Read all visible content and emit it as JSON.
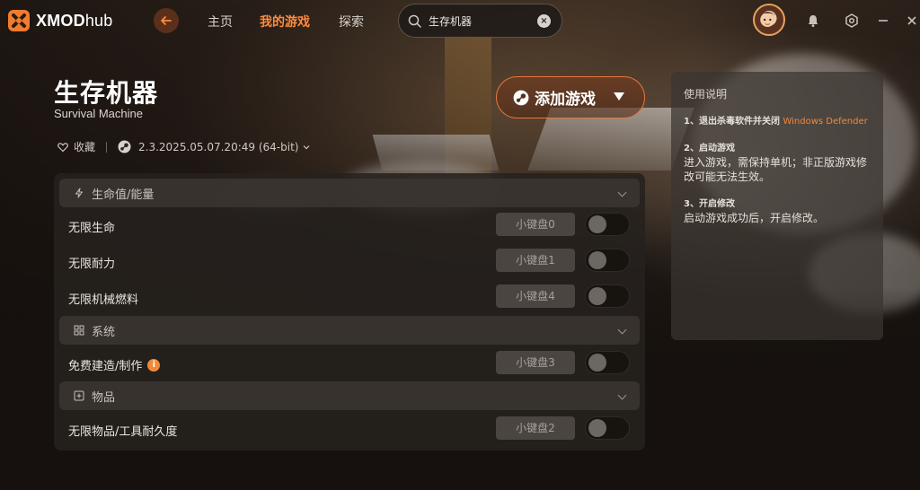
{
  "app": {
    "name_part1": "XMOD",
    "name_part2": "hub"
  },
  "nav": {
    "items": [
      {
        "label": "主页"
      },
      {
        "label": "我的游戏"
      },
      {
        "label": "探索"
      }
    ],
    "active_index": 1
  },
  "search": {
    "value": "生存机器",
    "placeholder": ""
  },
  "game": {
    "title": "生存机器",
    "subtitle": "Survival Machine",
    "favorite_label": "收藏",
    "version": "2.3.2025.05.07.20:49 (64-bit)"
  },
  "add_game_button": {
    "label": "添加游戏"
  },
  "sections": [
    {
      "label": "生命值/能量",
      "icon": "lightning-icon",
      "items": [
        {
          "label": "无限生命",
          "hotkey": "小键盘0",
          "enabled": false,
          "info": false
        },
        {
          "label": "无限耐力",
          "hotkey": "小键盘1",
          "enabled": false,
          "info": false
        },
        {
          "label": "无限机械燃料",
          "hotkey": "小键盘4",
          "enabled": false,
          "info": false
        }
      ]
    },
    {
      "label": "系统",
      "icon": "grid-icon",
      "items": [
        {
          "label": "免费建造/制作",
          "hotkey": "小键盘3",
          "enabled": false,
          "info": true
        }
      ]
    },
    {
      "label": "物品",
      "icon": "box-plus-icon",
      "items": [
        {
          "label": "无限物品/工具耐久度",
          "hotkey": "小键盘2",
          "enabled": false,
          "info": false
        }
      ]
    }
  ],
  "instructions": {
    "title": "使用说明",
    "steps": [
      {
        "head": "1、退出杀毒软件并关闭",
        "head_accent": "Windows Defender",
        "body": ""
      },
      {
        "head": "2、启动游戏",
        "head_accent": "",
        "body": "进入游戏，需保持单机；非正版游戏修改可能无法生效。"
      },
      {
        "head": "3、开启修改",
        "head_accent": "",
        "body": "启动游戏成功后，开启修改。"
      }
    ]
  },
  "colors": {
    "accent": "#ff8a3c",
    "panel": "#26211e",
    "hotkey_bg": "#4a4541"
  }
}
